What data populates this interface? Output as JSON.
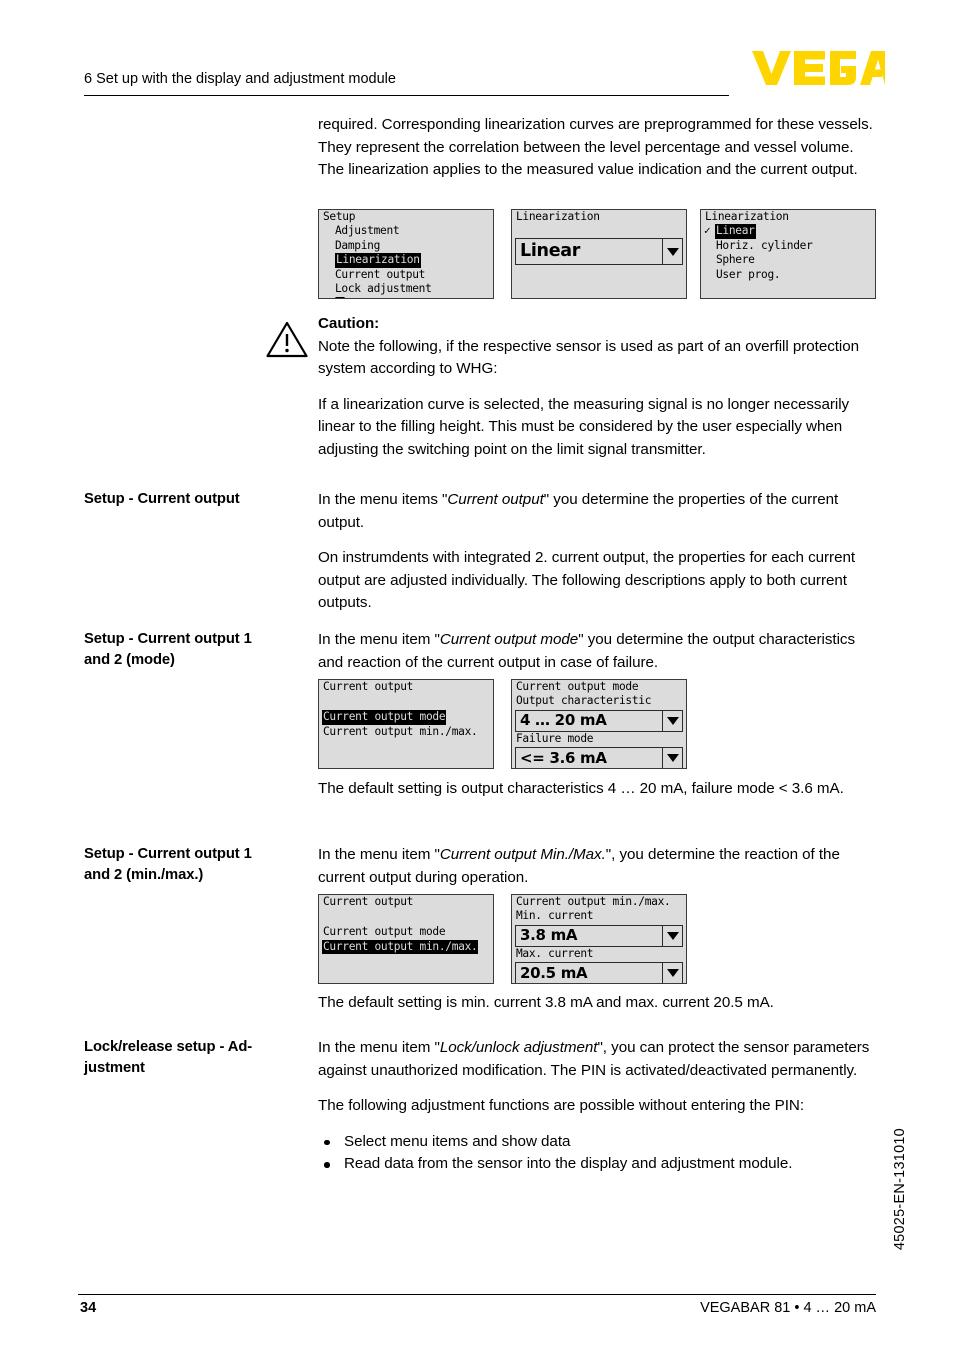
{
  "header": {
    "chapter_title": "6 Set up with the display and adjustment module",
    "logo_text": "VEGA",
    "logo_color": "#FFD500"
  },
  "intro": {
    "paragraph": "required. Corresponding linearization curves are preprogrammed for these vessels. They represent the correlation between the level percentage and vessel volume. The linearization applies to the measured value indication and the current output."
  },
  "screens_linearization": {
    "screen1": {
      "title": "Setup",
      "items": [
        "Adjustment",
        "Damping",
        "Linearization",
        "Current output",
        "Lock adjustment"
      ],
      "selected": "Linearization",
      "more_indicator": "scroll-down-arrow"
    },
    "screen2": {
      "title": "Linearization",
      "value": "Linear",
      "dropdown_icon": "chevron-down-icon"
    },
    "screen3": {
      "title": "Linearization",
      "items": [
        "Linear",
        "Horiz. cylinder",
        "Sphere",
        "User prog."
      ],
      "selected": "Linear",
      "checkmark": "✓"
    }
  },
  "caution": {
    "icon": "warning-triangle-icon",
    "title": "Caution:",
    "paragraph1": "Note the following, if the respective sensor is used as part of an overfill protection system according to WHG:",
    "paragraph2": "If a linearization curve is selected, the measuring signal is no longer necessarily linear to the filling height. This must be considered by the user especially when adjusting the switching point on the limit signal transmitter."
  },
  "section_current_output": {
    "marginal": "Setup - Current output",
    "paragraph1_pre": "In the menu items \"",
    "paragraph1_em": "Current output",
    "paragraph1_post": "\" you determine the properties of the current output.",
    "paragraph2": "On instrumdents with integrated 2. current output, the properties for each current output are adjusted individually. The following descriptions apply to both current outputs."
  },
  "section_mode": {
    "marginal_line1": "Setup - Current output 1",
    "marginal_line2": "and 2 (mode)",
    "paragraph_pre": "In the menu item \"",
    "paragraph_em": "Current output mode",
    "paragraph_post": "\" you determine the output characteristics and reaction of the current output in case of failure.",
    "screens": {
      "left": {
        "title": "Current output",
        "items": [
          "Current output mode",
          "Current output min./max."
        ],
        "selected": "Current output mode"
      },
      "right": {
        "title": "Current output mode",
        "label1": "Output characteristic",
        "value1": "4 … 20 mA",
        "label2": "Failure mode",
        "value2": "<= 3.6 mA",
        "dropdown_icon": "chevron-down-icon"
      }
    },
    "default_note": "The default setting is output characteristics 4 … 20 mA, failure mode < 3.6 mA."
  },
  "section_minmax": {
    "marginal_line1": "Setup - Current output 1",
    "marginal_line2": "and 2 (min./max.)",
    "paragraph_pre": "In the menu item \"",
    "paragraph_em": "Current output Min./Max.",
    "paragraph_post": "\", you determine the reaction of the current output during operation.",
    "screens": {
      "left": {
        "title": "Current output",
        "items": [
          "Current output mode",
          "Current output min./max."
        ],
        "selected": "Current output min./max."
      },
      "right": {
        "title": "Current output min./max.",
        "label1": "Min. current",
        "value1": "3.8 mA",
        "label2": "Max. current",
        "value2": "20.5 mA",
        "dropdown_icon": "chevron-down-icon"
      }
    },
    "default_note": "The default setting is min. current 3.8 mA and max. current 20.5 mA."
  },
  "section_lock": {
    "marginal_line1": "Lock/release setup - Ad-",
    "marginal_line2": "justment",
    "paragraph_pre": "In the menu item \"",
    "paragraph_em": "Lock/unlock adjustment",
    "paragraph_post": "\", you can protect the sensor parameters against unauthorized modification. The PIN is activated/deactivated permanently.",
    "paragraph2": "The following adjustment functions are possible without entering the PIN:",
    "bullets": [
      "Select menu items and show data",
      "Read data from the sensor into the display and adjustment module."
    ]
  },
  "side_code": "45025-EN-131010",
  "footer": {
    "page_number": "34",
    "product": "VEGABAR 81 • 4 … 20 mA"
  }
}
